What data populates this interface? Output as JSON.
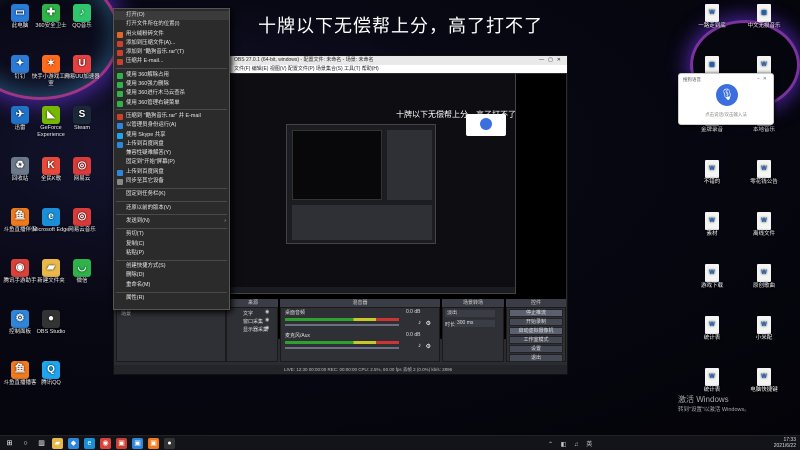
{
  "background_text": "十牌以下无偿帮上分，高了打不了",
  "desktop_icons_left": [
    {
      "label": "此电脑",
      "glyph": "▭",
      "color": "#2a7bd6"
    },
    {
      "label": "钉钉",
      "glyph": "✦",
      "color": "#2a7bd6"
    },
    {
      "label": "迅雷",
      "glyph": "✈",
      "color": "#1e73c8"
    },
    {
      "label": "回收站",
      "glyph": "♻",
      "color": "#6a7a8a"
    },
    {
      "label": "斗鱼直播伴侣",
      "glyph": "鱼",
      "color": "#f07a1e"
    },
    {
      "label": "腾讯手游助手",
      "glyph": "◉",
      "color": "#d9423a"
    },
    {
      "label": "控制面板",
      "glyph": "⚙",
      "color": "#2d86d9"
    },
    {
      "label": "斗鱼直播播客",
      "glyph": "鱼",
      "color": "#f07a1e"
    },
    {
      "label": "360安全卫士",
      "glyph": "✚",
      "color": "#2fb24a"
    },
    {
      "label": "快手小游戏工作室",
      "glyph": "✶",
      "color": "#ff6a1c"
    },
    {
      "label": "GeForce Experience",
      "glyph": "◣",
      "color": "#76b900"
    },
    {
      "label": "全民K歌",
      "glyph": "K",
      "color": "#e64a3b"
    },
    {
      "label": "Microsoft Edge",
      "glyph": "e",
      "color": "#1a8fd8"
    },
    {
      "label": "新建文件夹",
      "glyph": "▰",
      "color": "#e8b84a"
    },
    {
      "label": "OBS Studio",
      "glyph": "●",
      "color": "#333"
    },
    {
      "label": "腾讯QQ",
      "glyph": "Q",
      "color": "#1ea5f0"
    },
    {
      "label": "QQ音乐",
      "glyph": "♪",
      "color": "#2fc56c"
    },
    {
      "label": "网易UU加速器",
      "glyph": "U",
      "color": "#e64040"
    },
    {
      "label": "Steam",
      "glyph": "S",
      "color": "#1b2838"
    },
    {
      "label": "网易云",
      "glyph": "◎",
      "color": "#d93a3a"
    },
    {
      "label": "网易云音乐",
      "glyph": "◎",
      "color": "#d93a3a"
    },
    {
      "label": "微信",
      "glyph": "◡",
      "color": "#2fb24a"
    }
  ],
  "desktop_icons_right": [
    {
      "label": "一路走到底",
      "glyph": "W"
    },
    {
      "label": "中文无损音乐",
      "glyph": "▣"
    },
    {
      "label": "图片素材",
      "glyph": "▣"
    },
    {
      "label": "数字6",
      "glyph": "W"
    },
    {
      "label": "金牌录音",
      "glyph": "W"
    },
    {
      "label": "本地音乐",
      "glyph": "W"
    },
    {
      "label": "不错的",
      "glyph": "W"
    },
    {
      "label": "零花钱公告",
      "glyph": "W"
    },
    {
      "label": "素材",
      "glyph": "W"
    },
    {
      "label": "离线文件",
      "glyph": "W"
    },
    {
      "label": "游戏下载",
      "glyph": "W"
    },
    {
      "label": "原创歌曲",
      "glyph": "W"
    },
    {
      "label": "统计表",
      "glyph": "W"
    },
    {
      "label": "小米配",
      "glyph": "W"
    },
    {
      "label": "统计表",
      "glyph": "W"
    },
    {
      "label": "电脑快捷键",
      "glyph": "W"
    }
  ],
  "context_menu": [
    {
      "label": "打开(O)",
      "icon": null
    },
    {
      "label": "打开文件所在的位置(I)",
      "icon": null
    },
    {
      "label": "用火绒粉碎文件",
      "icon": "#e0672a"
    },
    {
      "label": "添加到压缩文件(A)...",
      "icon": "#c9402e"
    },
    {
      "label": "添加到 \"酷狗音乐.rar\"(T)",
      "icon": "#c9402e"
    },
    {
      "label": "压缩并 E-mail...",
      "icon": "#c9402e"
    },
    {
      "sep": true
    },
    {
      "label": "使用 360解除占用",
      "icon": "#2fb24a"
    },
    {
      "label": "使用 360强力删除",
      "icon": "#2fb24a"
    },
    {
      "label": "使用 360进行木马云查杀",
      "icon": "#2fb24a"
    },
    {
      "label": "使用 360管理右键菜单",
      "icon": "#2fb24a"
    },
    {
      "sep": true
    },
    {
      "label": "压缩到 \"酷狗音乐.rar\" 并 E-mail",
      "icon": "#c9402e"
    },
    {
      "label": "以管理员身份运行(A)",
      "icon": "#2d86d9"
    },
    {
      "label": "使用 Skype 共享",
      "icon": "#1ea5f0"
    },
    {
      "label": "上传到百度网盘",
      "icon": "#2d86d9"
    },
    {
      "label": "兼容性疑难解答(Y)",
      "icon": null
    },
    {
      "label": "固定到\"开始\"屏幕(P)",
      "icon": null
    },
    {
      "label": "上传到百度网盘",
      "icon": "#2d86d9"
    },
    {
      "label": "同步至其它设备",
      "icon": "#888"
    },
    {
      "sep": true
    },
    {
      "label": "固定到任务栏(K)",
      "icon": null
    },
    {
      "sep": true
    },
    {
      "label": "还原以前的版本(V)",
      "icon": null
    },
    {
      "sep": true
    },
    {
      "label": "发送到(N)",
      "icon": null,
      "submenu": true
    },
    {
      "sep": true
    },
    {
      "label": "剪切(T)",
      "icon": null
    },
    {
      "label": "复制(C)",
      "icon": null
    },
    {
      "label": "粘贴(P)",
      "icon": null
    },
    {
      "sep": true
    },
    {
      "label": "创建快捷方式(S)",
      "icon": null
    },
    {
      "label": "删除(D)",
      "icon": null
    },
    {
      "label": "重命名(M)",
      "icon": null
    },
    {
      "sep": true
    },
    {
      "label": "属性(R)",
      "icon": null
    }
  ],
  "obs": {
    "title": "OBS 27.0.1 (64-bit, windows) - 配置文件: 未命名 - 场景: 未命名",
    "menubar": "文件(F)  编辑(E)  视图(V)  配置文件(P)  场景集合(S)  工具(T)  帮助(H)",
    "preview_text": "十牌以下无偿帮上分，高了打不了",
    "docks": {
      "scenes": "场景",
      "sources": "来源",
      "mixer": "混音器",
      "transitions": "场景转场",
      "controls": "控件"
    },
    "sources": [
      "文字",
      "窗口采集",
      "显示器采集"
    ],
    "scene": "场景",
    "mixer": [
      {
        "name": "桌面音频",
        "db": "0.0 dB"
      },
      {
        "name": "麦克风/Aux",
        "db": "0.0 dB"
      }
    ],
    "transition": {
      "name": "淡出",
      "duration_label": "时长",
      "duration": "300 ms"
    },
    "controls": [
      "停止推流",
      "开始录制",
      "启动虚拟摄像机",
      "工作室模式",
      "设置",
      "退出"
    ],
    "status": "LIVE: 12:30  00:00:00   REC: 00:00:00   CPU: 2.5%, 60.00 fps   丢帧 2 (0.0%)   kb/s: 2896"
  },
  "voice_popup": {
    "title": "搜狗语音",
    "hint": "点击说话/双击输入法"
  },
  "activation": {
    "line1": "激活 Windows",
    "line2": "转到\"设置\"以激活 Windows。"
  },
  "tray": {
    "time": "17:33",
    "date": "2021/6/22"
  },
  "taskbar_icons": [
    {
      "name": "start",
      "glyph": "⊞",
      "color": "#121419"
    },
    {
      "name": "search",
      "glyph": "○",
      "color": "#121419"
    },
    {
      "name": "task-view",
      "glyph": "▥",
      "color": "#121419"
    },
    {
      "name": "explorer",
      "glyph": "▰",
      "color": "#e8b84a"
    },
    {
      "name": "store",
      "glyph": "◆",
      "color": "#2d86d9"
    },
    {
      "name": "edge",
      "glyph": "e",
      "color": "#1a8fd8"
    },
    {
      "name": "chrome",
      "glyph": "◉",
      "color": "#d9423a"
    },
    {
      "name": "app-red",
      "glyph": "▣",
      "color": "#c9402e"
    },
    {
      "name": "app-blue",
      "glyph": "▣",
      "color": "#2d86d9"
    },
    {
      "name": "app-orange",
      "glyph": "▣",
      "color": "#f07a1e"
    },
    {
      "name": "obs",
      "glyph": "●",
      "color": "#333"
    }
  ]
}
